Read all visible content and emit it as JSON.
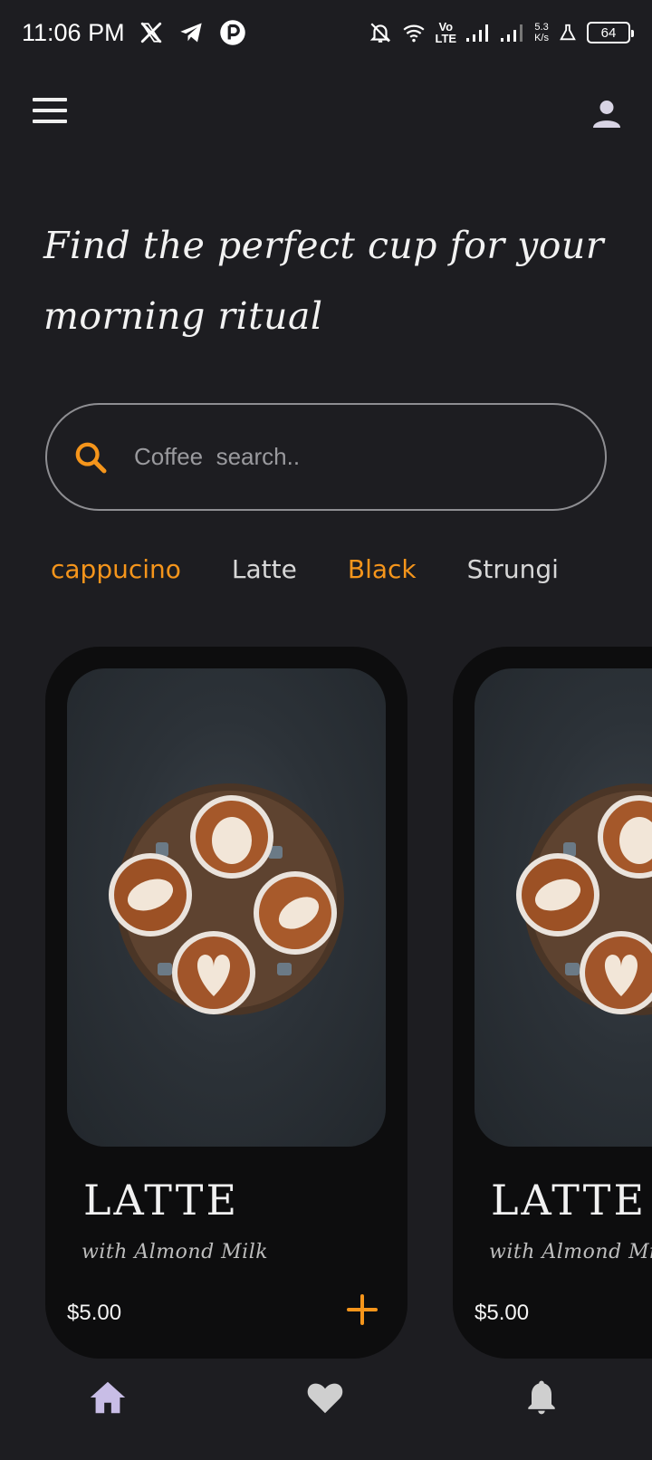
{
  "status_bar": {
    "time": "11:06 PM",
    "left_icons": [
      "x-icon",
      "telegram-icon",
      "app-icon"
    ],
    "lte_line1": "Vo",
    "lte_line2": "LTE",
    "speed_line1": "5.3",
    "speed_line2": "K/s",
    "battery": "64"
  },
  "header": {
    "headline_line1": "Find the perfect cup for your",
    "headline_line2": "morning ritual"
  },
  "search": {
    "placeholder": "Coffee  search.."
  },
  "categories": [
    {
      "label": "cappucino",
      "active": true
    },
    {
      "label": "Latte",
      "active": false
    },
    {
      "label": "Black",
      "active": true
    },
    {
      "label": "Strungi",
      "active": false
    }
  ],
  "products": [
    {
      "title": "LATTE",
      "subtitle": "with Almond Milk",
      "price": "$5.00"
    },
    {
      "title": "LATTE",
      "subtitle": "with Almond Milk",
      "price": "$5.00"
    }
  ],
  "colors": {
    "background": "#1d1d21",
    "card": "#0d0d0e",
    "accent": "#f5951b",
    "nav_home": "#c8bde6",
    "nav_inactive": "#cfcfcf"
  },
  "bottom_nav": [
    "home-icon",
    "heart-icon",
    "bell-icon"
  ]
}
